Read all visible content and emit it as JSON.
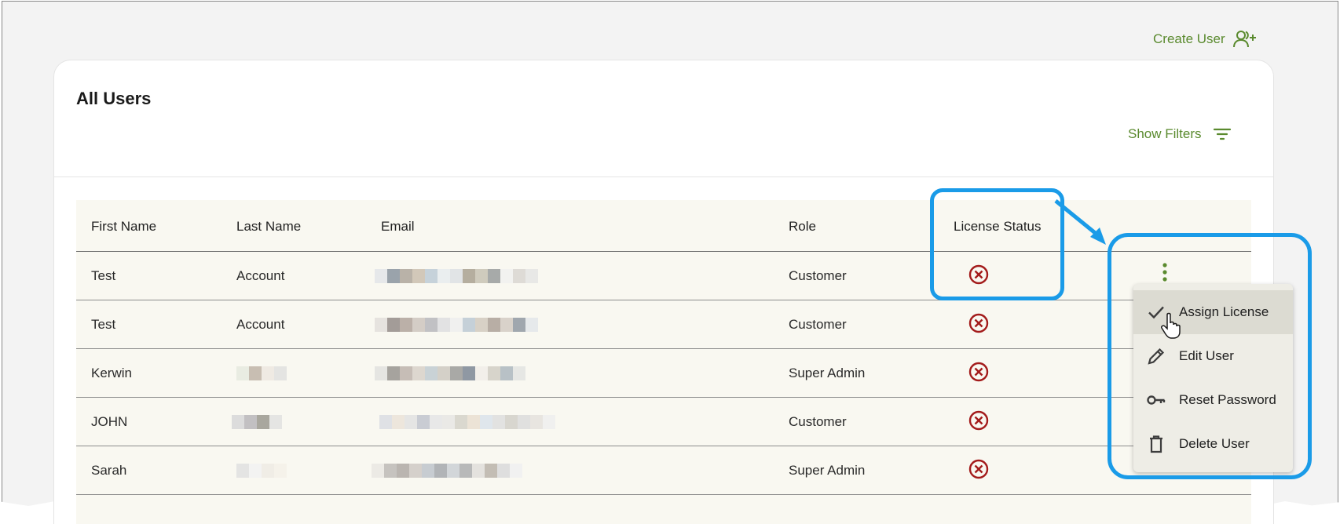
{
  "header": {
    "create_user_label": "Create User",
    "create_user_icon": "add-user-icon"
  },
  "card": {
    "title": "All Users",
    "show_filters_label": "Show Filters",
    "filter_icon": "filter-icon"
  },
  "table": {
    "columns": [
      "First Name",
      "Last Name",
      "Email",
      "Role",
      "License Status"
    ],
    "rows": [
      {
        "first": "Test",
        "last": "Account",
        "role": "Customer",
        "license_icon": "x-circle-icon"
      },
      {
        "first": "Test",
        "last": "Account",
        "role": "Customer",
        "license_icon": "x-circle-icon"
      },
      {
        "first": "Kerwin",
        "last": "",
        "role": "Super Admin",
        "license_icon": "x-circle-icon"
      },
      {
        "first": "JOHN",
        "last": "",
        "role": "Customer",
        "license_icon": "x-circle-icon"
      },
      {
        "first": "Sarah",
        "last": "",
        "role": "Super Admin",
        "license_icon": "x-circle-icon"
      }
    ]
  },
  "row_menu": {
    "items": [
      {
        "label": "Assign License",
        "icon": "check-icon"
      },
      {
        "label": "Edit User",
        "icon": "pencil-icon"
      },
      {
        "label": "Reset Password",
        "icon": "key-icon"
      },
      {
        "label": "Delete User",
        "icon": "trash-icon"
      }
    ]
  },
  "colors": {
    "accent_green": "#5a8a2e",
    "error_red": "#a31b1b",
    "callout_blue": "#1a9be8",
    "table_bg": "#f9f8f1"
  }
}
